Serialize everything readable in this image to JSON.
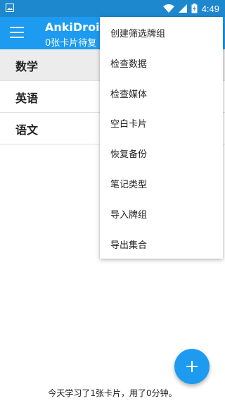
{
  "status_bar": {
    "time": "4:49"
  },
  "app_bar": {
    "title": "AnkiDroid",
    "subtitle": "0张卡片待复"
  },
  "decks": [
    {
      "label": "数学",
      "selected": true
    },
    {
      "label": "英语",
      "selected": false
    },
    {
      "label": "语文",
      "selected": false
    }
  ],
  "overflow_menu": {
    "items": [
      {
        "label": "创建筛选牌组"
      },
      {
        "label": "检查数据"
      },
      {
        "label": "检查媒体"
      },
      {
        "label": "空白卡片"
      },
      {
        "label": "恢复备份"
      },
      {
        "label": "笔记类型"
      },
      {
        "label": "导入牌组"
      },
      {
        "label": "导出集合"
      }
    ]
  },
  "footer": {
    "text": "今天学习了1张卡片，用了0分钟。"
  },
  "colors": {
    "status_bar": "#1e88cf",
    "app_bar": "#1d9bf0",
    "selected_row": "#ececec"
  }
}
